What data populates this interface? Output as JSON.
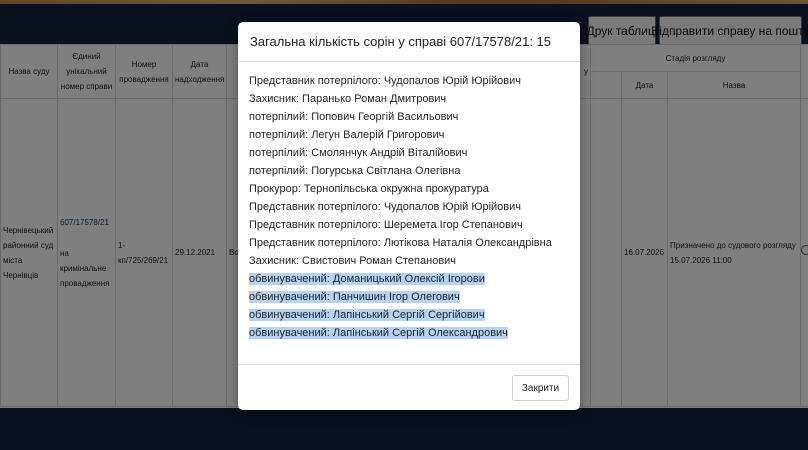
{
  "toolbar": {
    "print_label": "Друк таблиці",
    "send_label": "Відправити справу на пошту"
  },
  "table": {
    "headers": {
      "court": "Назва суду",
      "case_number": "Єдиний унікальний номер справи",
      "proceeding": "Номер провадження",
      "date_received": "Дата надходження",
      "partial_col": "у",
      "stage_group": "Стадія розгляду",
      "stage_date": "Дата",
      "stage_name": "Назва"
    },
    "row": {
      "court": "Чернівецький районний суд міста Чернівців",
      "case_number": "607/17578/21",
      "case_type": "на кримінальне провадження",
      "proceeding": "1-кп/725/269/21",
      "date_received": "29.12.2021",
      "partial_text": "Во",
      "stage_date": "16.07.2026",
      "stage_name": "Призначено до судового розгляду 15.07.2026 11:00"
    }
  },
  "modal": {
    "title": "Загальна кількість сорін у справі 607/17578/21: 15",
    "parties": [
      "Представник потерпілого: Чудопалов Юрій Юрійович",
      "Захисник: Паранько Роман Дмитрович",
      "потерпілий: Попович Георгій Васильович",
      "потерпілий: Легун Валерій Григорович",
      "потерпілий: Смолянчук Андрій Віталійович",
      "потерпілий: Погурська Світлана Олегівна",
      "Прокурор: Тернопільська окружна прокуратура",
      "Представник потерпілого: Чудопалов Юрій Юрійович",
      "Представник потерпілого: Шеремета Ігор Степанович",
      "Представник потерпілого: Лютікова Наталія Олександрівна",
      "Захисник: Свистович Роман Степанович",
      "обвинувачений: Доманицький Олексій Ігорови",
      "обвинувачений: Панчишин Ігор Олегович",
      "обвинувачений: Лапінський Сергій Сергійович",
      "обвинувачений: Лапінський Сергій Олександрович"
    ],
    "close_label": "Закрити"
  },
  "colors": {
    "navbar": "#12233f",
    "selection": "#b5d2f0",
    "link": "#1f3c73"
  }
}
